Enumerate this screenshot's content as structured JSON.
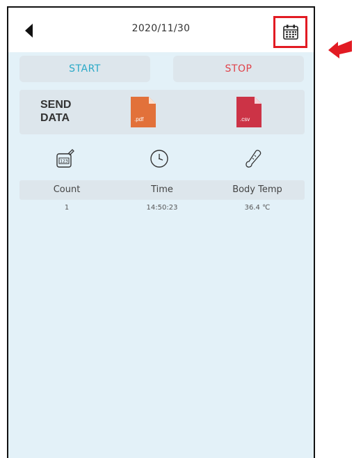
{
  "header": {
    "date": "2020/11/30",
    "back_icon": "back-arrow-icon",
    "calendar_icon": "calendar-icon"
  },
  "controls": {
    "start_label": "START",
    "stop_label": "STOP"
  },
  "send_data": {
    "label_line1": "SEND",
    "label_line2": "DATA",
    "pdf_ext": ".pdf",
    "csv_ext": ".csv"
  },
  "table": {
    "columns": [
      "Count",
      "Time",
      "Body Temp"
    ],
    "column_icons": [
      "counter-icon",
      "clock-icon",
      "thermometer-icon"
    ],
    "rows": [
      [
        "1",
        "14:50:23",
        "36.4 ℃"
      ]
    ]
  },
  "colors": {
    "start": "#2aa9c7",
    "stop": "#e0424a",
    "pdf": "#e2713a",
    "csv": "#cc3346",
    "highlight": "#e21b23",
    "background": "#e3f1f8"
  }
}
